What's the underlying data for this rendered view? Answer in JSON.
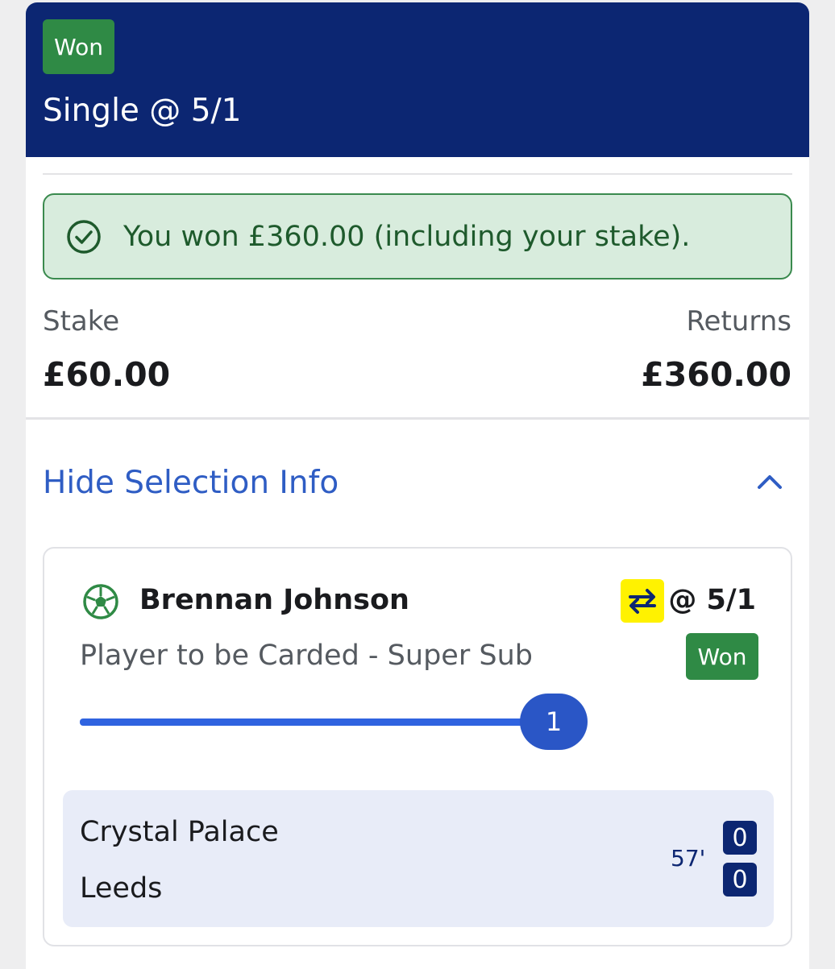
{
  "header": {
    "status": "Won",
    "title": "Single @ 5/1"
  },
  "banner": {
    "icon": "check-circle-icon",
    "text": "You won £360.00 (including your stake)."
  },
  "summary": {
    "stake_label": "Stake",
    "stake_value": "£60.00",
    "returns_label": "Returns",
    "returns_value": "£360.00"
  },
  "selection_toggle": {
    "label": "Hide Selection Info",
    "icon": "chevron-up-icon"
  },
  "selection": {
    "sport_icon": "football-icon",
    "player": "Brennan Johnson",
    "boost_icon": "super-sub-icon",
    "odds": "@ 5/1",
    "market": "Player to be Carded - Super Sub",
    "status": "Won",
    "progress_count": "1",
    "progress_fraction": 1.0
  },
  "event": {
    "home_team": "Crystal Palace",
    "away_team": "Leeds",
    "clock": "57'",
    "home_score": "0",
    "away_score": "0"
  },
  "colors": {
    "header_bg": "#0c2672",
    "won_green": "#2f8a45",
    "banner_bg": "#d8ecdd",
    "link_blue": "#2f5dc4",
    "boost_yellow": "#fff200"
  }
}
